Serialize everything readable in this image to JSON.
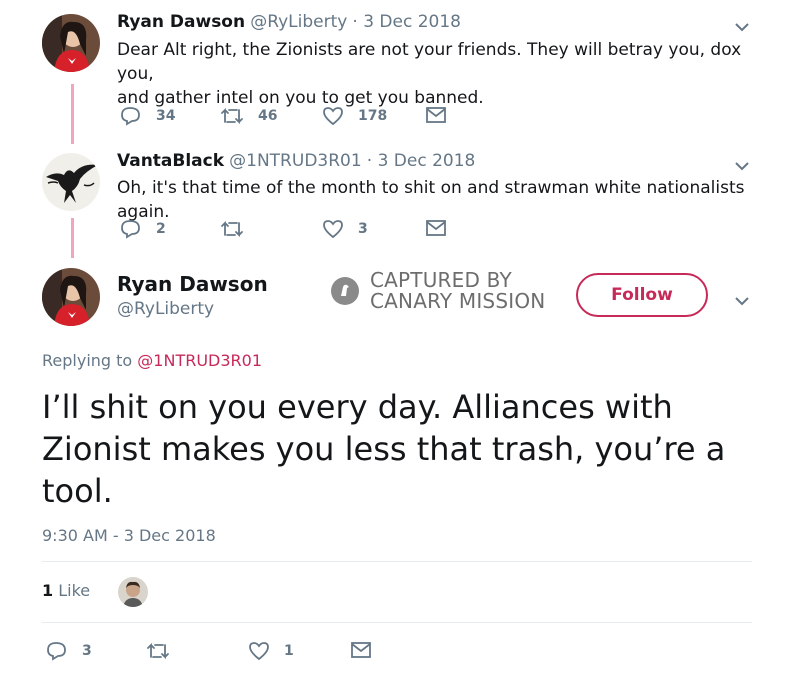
{
  "tweet1": {
    "name": "Ryan Dawson",
    "handle": "@RyLiberty",
    "date": "· 3 Dec 2018",
    "text_line1": "Dear Alt right, the Zionists are not your friends. They will betray you, dox you,",
    "text_line2": "and gather intel on you to get you banned.",
    "replies": "34",
    "retweets": "46",
    "likes": "178"
  },
  "tweet2": {
    "name": "VantaBlack",
    "handle": "@1NTRUD3R01",
    "date": "· 3 Dec 2018",
    "text": "Oh, it's that time of the month to shit on and strawman white nationalists again.",
    "replies": "2",
    "retweets": "",
    "likes": "3"
  },
  "main_tweet": {
    "name": "Ryan Dawson",
    "handle": "@RyLiberty",
    "follow_label": "Follow",
    "replying_prefix": "Replying to",
    "replying_to": "@1NTRUD3R01",
    "text": "I’ll shit on you every day. Alliances with Zionist makes you less that trash, you’re a tool.",
    "timestamp": "9:30 AM - 3 Dec 2018",
    "like_count": "1",
    "like_label": "Like",
    "replies": "3",
    "likes": "1"
  },
  "watermark": {
    "line1": "CAPTURED BY",
    "line2": "CANARY MISSION"
  },
  "colors": {
    "accent": "#c62a58",
    "thread_line": "#f0a6c1",
    "muted": "#657786"
  }
}
